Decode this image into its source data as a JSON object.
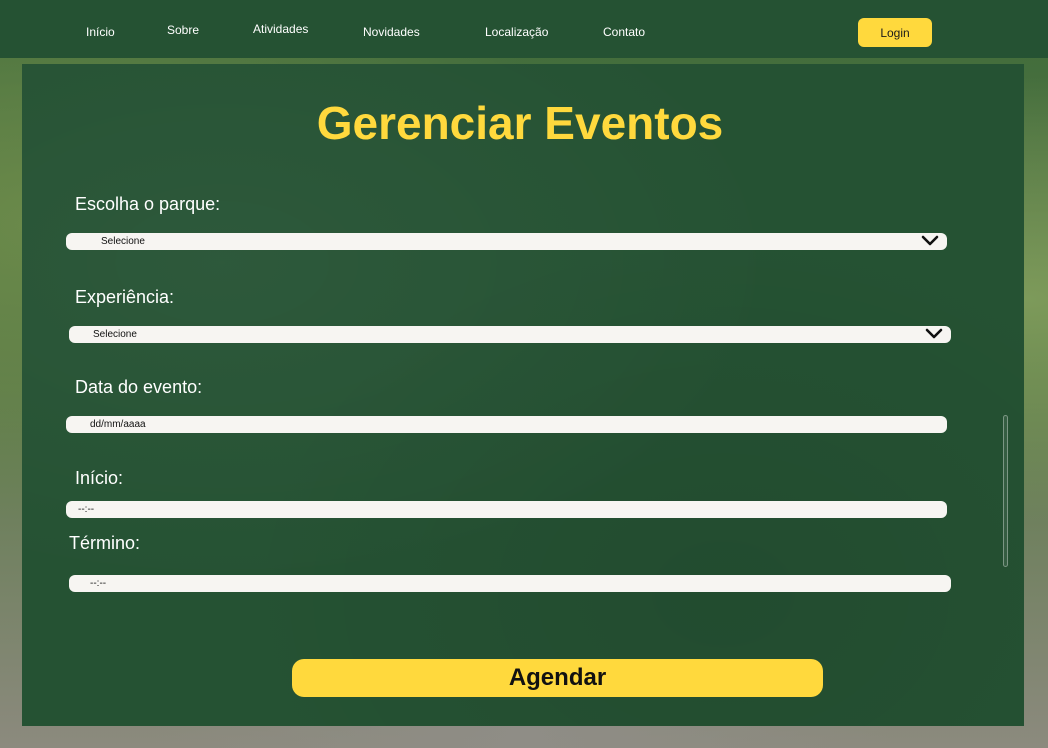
{
  "nav": {
    "links": [
      "Início",
      "Sobre",
      "Atividades",
      "Novidades",
      "Localização",
      "Contato"
    ],
    "login_label": "Login"
  },
  "page": {
    "title": "Gerenciar Eventos"
  },
  "form": {
    "park": {
      "label": "Escolha o parque:",
      "value": "Selecione"
    },
    "experience": {
      "label": "Experiência:",
      "value": "Selecione"
    },
    "date": {
      "label": "Data do evento:",
      "value": "dd/mm/aaaa"
    },
    "start": {
      "label": "Início:",
      "value": "--:--"
    },
    "end": {
      "label": "Término:",
      "value": "--:--"
    },
    "submit_label": "Agendar"
  },
  "colors": {
    "primary_green": "#255233",
    "accent_yellow": "#ffd93d",
    "input_bg": "#f7f5f2"
  }
}
